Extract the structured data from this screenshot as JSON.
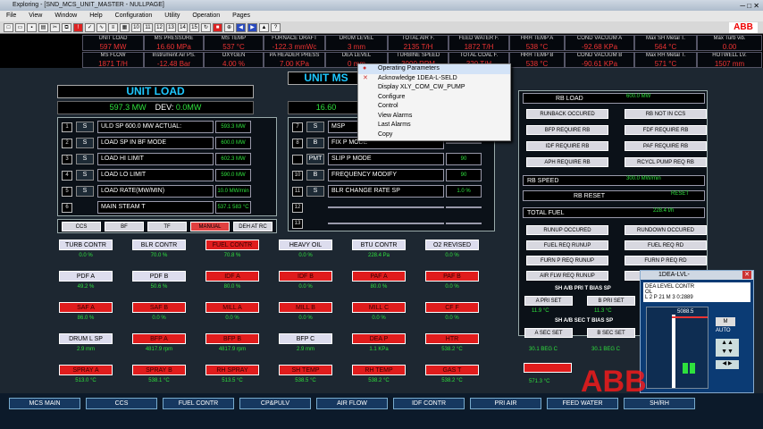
{
  "window": {
    "title": "Exploring - [SND_MCS_UNIT_MASTER - NULLPAGE]"
  },
  "menu": [
    "File",
    "View",
    "Window",
    "Help",
    "Configuration",
    "Utility",
    "Operation",
    "Pages"
  ],
  "toolbar": {
    "page_numbers": [
      "10",
      "11",
      "12",
      "13",
      "14",
      "15"
    ],
    "logo": "ABB"
  },
  "kpi": [
    {
      "label": "UNIT LOAD",
      "value": "597 MW"
    },
    {
      "label": "MS PRESSURE",
      "value": "16.60 MPa"
    },
    {
      "label": "MS TEMP",
      "value": "537 °C"
    },
    {
      "label": "FURNACE DRAFT",
      "value": "-122.3 mmWc"
    },
    {
      "label": "DRUM LEVEL",
      "value": "3 mm"
    },
    {
      "label": "TOTAL AIR F.",
      "value": "2135 T/H"
    },
    {
      "label": "FEED WATER F.",
      "value": "1872 T/H"
    },
    {
      "label": "HRH TEMP A",
      "value": "538 °C"
    },
    {
      "label": "COND VACUUM A",
      "value": "-92.68 KPa"
    },
    {
      "label": "Max SH Metal T.",
      "value": "564 °C"
    },
    {
      "label": "Max Turb vib.",
      "value": "0.00"
    },
    {
      "label": "MS FLOW",
      "value": "1871 T/H"
    },
    {
      "label": "Instrument Air PS.",
      "value": "-12.48 Bar"
    },
    {
      "label": "OXYGEN",
      "value": "4.00 %"
    },
    {
      "label": "PA HEADER PRESS",
      "value": "7.00 KPa"
    },
    {
      "label": "DEA LEVEL",
      "value": "0 mm"
    },
    {
      "label": "TURBINE SPEED",
      "value": "3000 RPM"
    },
    {
      "label": "TOTAL COAL F.",
      "value": "320 T/H"
    },
    {
      "label": "HRH TEMP B",
      "value": "538 °C"
    },
    {
      "label": "COND VACUUM B",
      "value": "-90.61 KPa"
    },
    {
      "label": "Max RH Metal T.",
      "value": "571 °C"
    },
    {
      "label": "HOTWELL LV.",
      "value": "1507 mm"
    }
  ],
  "unit_load": {
    "title": "UNIT LOAD",
    "value": "597.3 MW",
    "dev_label": "DEV:",
    "dev_value": "0.0MW",
    "rows": [
      {
        "num": "1",
        "btn": "S",
        "label": "ULD SP  600.0 MW  ACTUAL:",
        "value": "593.3 MW"
      },
      {
        "num": "2",
        "btn": "S",
        "label": "LOAD SP IN BF MODE",
        "value": "600.0 MW"
      },
      {
        "num": "3",
        "btn": "S",
        "label": "LOAD HI LIMIT",
        "value": "602.3 MW"
      },
      {
        "num": "4",
        "btn": "S",
        "label": "LOAD LO LIMIT",
        "value": "590.0 MW"
      },
      {
        "num": "5",
        "btn": "S",
        "label": "LOAD RATE(MW/MIN)",
        "value": "10.0 MW/min"
      },
      {
        "num": "6",
        "btn": "",
        "label": "MAIN STEAM T",
        "value": "537.1 583 °C"
      }
    ],
    "modes": [
      "CCS",
      "BF",
      "TF",
      "MANUAL",
      "DEH AT RC"
    ]
  },
  "unit_ms": {
    "title": "UNIT MS",
    "value": "16.60",
    "rows": [
      {
        "num": "7",
        "btn": "S",
        "label": "MSP",
        "value": ""
      },
      {
        "num": "8",
        "btn": "B",
        "label": "FIX P MODE",
        "value": ""
      },
      {
        "num": "",
        "btn": "PMT",
        "label": "SLIP P MODE",
        "value": "90"
      },
      {
        "num": "10",
        "btn": "B",
        "label": "FREQUENCY MODIFY",
        "value": "90"
      },
      {
        "num": "11",
        "btn": "S",
        "label": "BLR CHANGE RATE SP",
        "value": "1.0 %"
      },
      {
        "num": "12",
        "btn": "",
        "label": "",
        "value": ""
      },
      {
        "num": "13",
        "btn": "",
        "label": "",
        "value": ""
      }
    ]
  },
  "tiles": [
    {
      "label": "TURB CONTR",
      "value": "0.0 %",
      "red": false
    },
    {
      "label": "BLR CONTR",
      "value": "70.0 %",
      "red": false
    },
    {
      "label": "FUEL CONTR",
      "value": "70.8 %",
      "red": true
    },
    {
      "label": "HEAVY OIL",
      "value": "0.0 %",
      "red": false
    },
    {
      "label": "BTU CONTR",
      "value": "228.4 Pa",
      "red": false
    },
    {
      "label": "O2 REVISED",
      "value": "0.0 %",
      "red": false
    },
    {
      "label": "PDF A",
      "value": "49.2 %",
      "red": false
    },
    {
      "label": "PDF B",
      "value": "50.6 %",
      "red": false
    },
    {
      "label": "IDF A",
      "value": "80.0 %",
      "red": true
    },
    {
      "label": "IDF B",
      "value": "0.0 %",
      "red": true
    },
    {
      "label": "PAF A",
      "value": "80.0 %",
      "red": true
    },
    {
      "label": "PAF B",
      "value": "0.0 %",
      "red": true
    },
    {
      "label": "SAF A",
      "value": "86.0 %",
      "red": true
    },
    {
      "label": "SAF B",
      "value": "0.0 %",
      "red": true
    },
    {
      "label": "MILL A",
      "value": "0.0 %",
      "red": true
    },
    {
      "label": "MILL B",
      "value": "0.0 %",
      "red": true
    },
    {
      "label": "MILL C",
      "value": "0.0 %",
      "red": true
    },
    {
      "label": "CF F",
      "value": "0.0 %",
      "red": true
    },
    {
      "label": "DRUM L SP",
      "value": "2.9 mm",
      "red": false
    },
    {
      "label": "BFP A",
      "value": "4817.9 rpm",
      "red": true
    },
    {
      "label": "BFP B",
      "value": "4817.9 rpm",
      "red": true
    },
    {
      "label": "BFP C",
      "value": "2.9 mm",
      "red": false
    },
    {
      "label": "DEA P",
      "value": "1.1 KPa",
      "red": true
    },
    {
      "label": "HTR",
      "value": "538.2 °C",
      "red": true
    },
    {
      "label": "SPRAY A",
      "value": "513.0 °C",
      "red": true
    },
    {
      "label": "SPRAY B",
      "value": "538.1 °C",
      "red": true
    },
    {
      "label": "RH SPRAY",
      "value": "513.5 °C",
      "red": true
    },
    {
      "label": "SH TEMP",
      "value": "538.5 °C",
      "red": true
    },
    {
      "label": "RH TEMP",
      "value": "538.2 °C",
      "red": true
    },
    {
      "label": "GAS T",
      "value": "538.2 °C",
      "red": true
    }
  ],
  "rb": {
    "title": "RB LOAD",
    "value": "600.0 MW",
    "btns": [
      "RUNBACK OCCURED",
      "RB NOT IN CCS",
      "BFP REQUIRE RB",
      "FDF REQUIRE RB",
      "IDF REQUIRE RB",
      "PAF REQUIRE RB",
      "APH REQUIRE RB",
      "RCYCL PUMP REQ RB"
    ],
    "speed_label": "RB SPEED",
    "speed_value": "300.0 MW/min",
    "reset_label": "RB RESET",
    "reset_value": "RESET",
    "fuel_label": "TOTAL FUEL",
    "fuel_value": "228.4 t/h",
    "btns2": [
      "RUNUP OCCURED",
      "RUNDOWN OCCURED",
      "FUEL REQ RUNUP",
      "FUEL REQ RD",
      "FURN P REQ RUNUP",
      "FURN P REQ RD",
      "AIR FLW REQ RUNUP",
      "AIR FLW REQ RD"
    ],
    "pri_bias": "SH A/B PRI T BIAS SP",
    "pri_a": "A PRI SET",
    "pri_b": "B PRI SET",
    "pri_a_val": "11.9 °C",
    "pri_b_val": "11.3 °C",
    "sec_bias": "SH A/B SEC T BIAS SP",
    "sec_a": "A SEC SET",
    "sec_b": "B SEC SET",
    "sec_a_val": "30.1 BEG C",
    "sec_b_val": "30.1 BEG C",
    "last": "571.3 °C"
  },
  "context_menu": [
    {
      "label": "Operating Parameters",
      "icon": "info-icon"
    },
    {
      "label": "Acknowledge 1DEA-L-SELD",
      "icon": "close-icon"
    },
    {
      "label": "Display XLY_COM_CW_PUMP",
      "icon": ""
    },
    {
      "label": "Configure",
      "icon": ""
    },
    {
      "label": "Control",
      "icon": ""
    },
    {
      "label": "View Alarms",
      "icon": ""
    },
    {
      "label": "Last Alarms",
      "icon": ""
    },
    {
      "label": "Copy",
      "icon": ""
    }
  ],
  "faceplate": {
    "title": "1DEA-LVL-",
    "line1": "DEA LEVEL CONTR",
    "line2": "OL",
    "line3": "L 2 P 21 M 3 0:2889",
    "sp": "5088.5",
    "mode": "AUTO",
    "m_btn": "M"
  },
  "nav": [
    "MCS MAIN",
    "CCS",
    "FUEL CONTR",
    "CP&PULV",
    "AIR FLOW",
    "IDF CONTR",
    "PRI AIR",
    "FEED WATER",
    "SH/RH"
  ],
  "watermark": "ABB"
}
